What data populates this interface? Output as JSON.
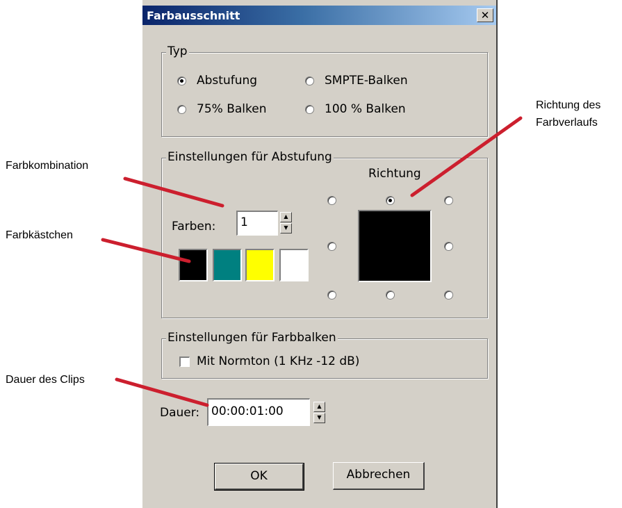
{
  "window": {
    "title": "Farbausschnitt"
  },
  "type_group": {
    "label": "Typ",
    "options": [
      {
        "label": "Abstufung",
        "checked": true
      },
      {
        "label": "SMPTE-Balken",
        "checked": false
      },
      {
        "label": "75% Balken",
        "checked": false
      },
      {
        "label": "100 % Balken",
        "checked": false
      }
    ]
  },
  "gradient_group": {
    "label": "Einstellungen für Abstufung",
    "colors_label": "Farben:",
    "colors_value": "1",
    "swatches": [
      "#000000",
      "#008080",
      "#ffff00",
      "#ffffff"
    ],
    "direction_label": "Richtung",
    "direction_selected": "top"
  },
  "bars_group": {
    "label": "Einstellungen für Farbbalken",
    "tone_label": "Mit Normton (1 KHz -12 dB)",
    "tone_checked": false
  },
  "duration": {
    "label": "Dauer:",
    "value": "00:00:01:00"
  },
  "buttons": {
    "ok": "OK",
    "cancel": "Abbrechen"
  },
  "annotations": {
    "color_combination": "Farbkombination",
    "color_boxes": "Farbkästchen",
    "clip_duration": "Dauer des Clips",
    "gradient_direction_line1": "Richtung des",
    "gradient_direction_line2": "Farbverlaufs"
  },
  "colors": {
    "annotation_line": "#cc1f2e",
    "dialog_bg": "#d4d0c8"
  }
}
